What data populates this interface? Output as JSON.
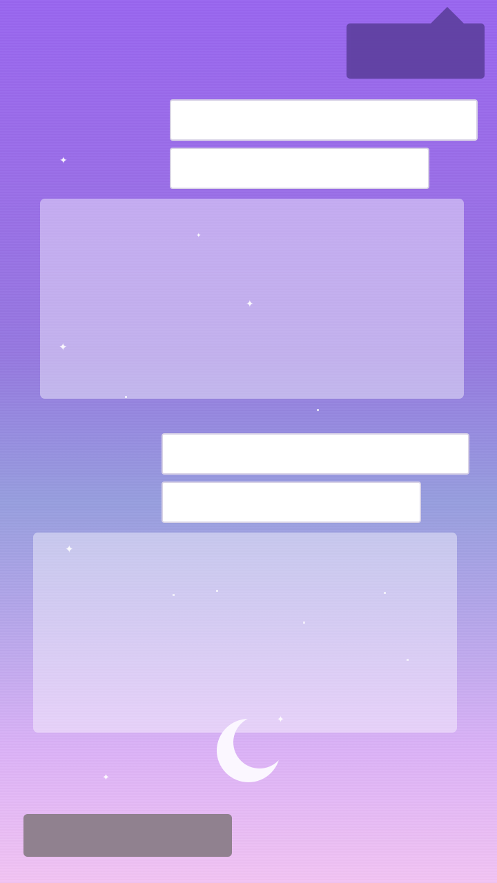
{
  "theme": {
    "tooltip_color": "#6041a2",
    "bottom_bar_color": "#90818f",
    "field_color": "#ffffff"
  },
  "tooltip": {
    "text": ""
  },
  "group_one": {
    "field_one": {
      "value": "",
      "placeholder": ""
    },
    "field_two": {
      "value": "",
      "placeholder": ""
    },
    "panel_text": ""
  },
  "group_two": {
    "field_one": {
      "value": "",
      "placeholder": ""
    },
    "field_two": {
      "value": "",
      "placeholder": ""
    },
    "panel_text": ""
  },
  "decoration": {
    "moon_icon": "crescent-moon-icon",
    "star_icon": "sparkle-star-icon"
  },
  "bottom_bar": {
    "label": ""
  }
}
